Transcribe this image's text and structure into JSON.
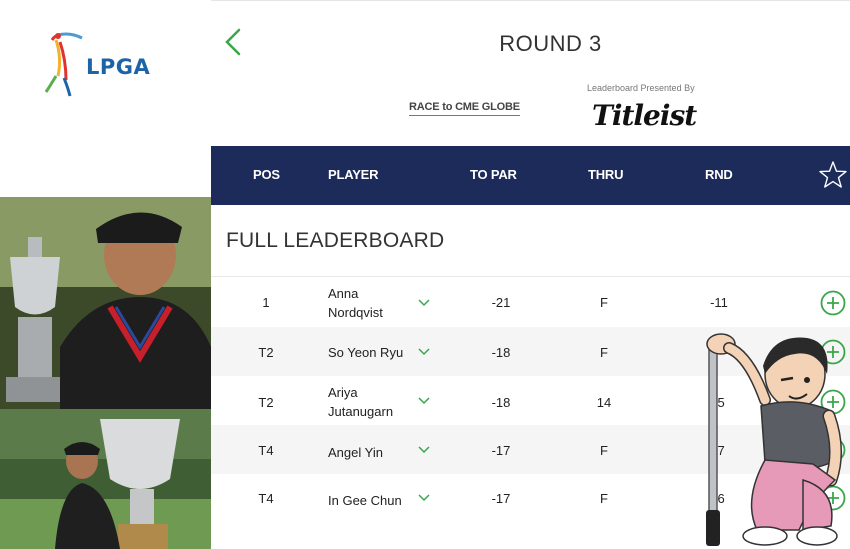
{
  "brand": {
    "logo_text": "LPGA"
  },
  "header": {
    "title": "ROUND 3",
    "race_logo": "RACE to CME GLOBE",
    "presented_by": "Leaderboard Presented By",
    "sponsor": "Titleist"
  },
  "columns": {
    "pos": "POS",
    "player": "PLAYER",
    "to_par": "TO PAR",
    "thru": "THRU",
    "rnd": "RND"
  },
  "section_title": "FULL LEADERBOARD",
  "rows": [
    {
      "pos": "1",
      "name_line1": "Anna",
      "name_line2": "Nordqvist",
      "to_par": "-21",
      "thru": "F",
      "rnd": "-11"
    },
    {
      "pos": "T2",
      "name_line1": "So Yeon Ryu",
      "name_line2": "",
      "to_par": "-18",
      "thru": "F",
      "rnd": ""
    },
    {
      "pos": "T2",
      "name_line1": "Ariya",
      "name_line2": "Jutanugarn",
      "to_par": "-18",
      "thru": "14",
      "rnd": "-5"
    },
    {
      "pos": "T4",
      "name_line1": "Angel Yin",
      "name_line2": "",
      "to_par": "-17",
      "thru": "F",
      "rnd": "-7"
    },
    {
      "pos": "T4",
      "name_line1": "In Gee Chun",
      "name_line2": "",
      "to_par": "-17",
      "thru": "F",
      "rnd": "-6"
    }
  ],
  "colors": {
    "header_bg": "#1c2b5a",
    "accent_green": "#3aa64a",
    "brand_blue": "#1d64a6"
  },
  "icons": {
    "back": "chevron-left-icon",
    "favorite": "star-outline-icon",
    "expand": "chevron-down-icon",
    "add": "plus-circle-icon"
  }
}
